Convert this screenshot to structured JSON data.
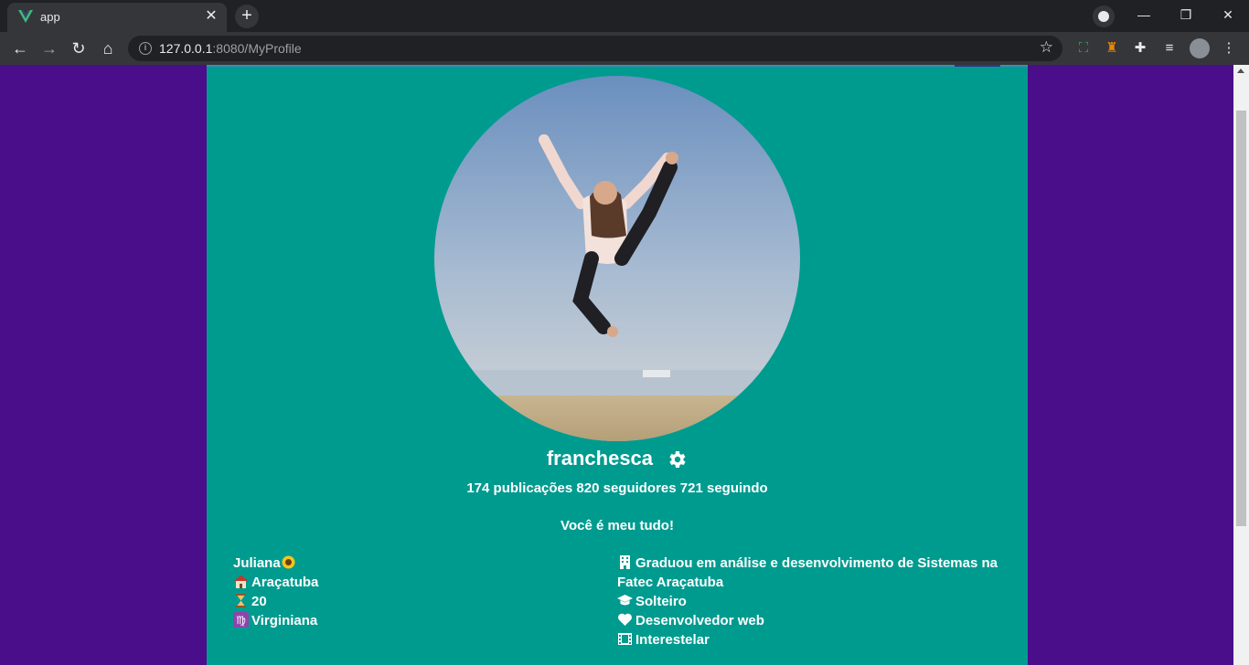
{
  "browser": {
    "tab_title": "app",
    "url_host": "127.0.0.1",
    "url_rest": ":8080/MyProfile"
  },
  "profile": {
    "username": "franchesca",
    "stats": "174 publicações 820 seguidores 721 seguindo",
    "bio": "Você é meu tudo!",
    "left_info": {
      "name": "Juliana",
      "city": "Araçatuba",
      "age": "20",
      "sign": "Virginiana"
    },
    "right_info": {
      "education_line1": "Graduou em análise e desenvolvimento de Sistemas na",
      "education_line2": "Fatec Araçatuba",
      "relationship": "Solteiro",
      "work": "Desenvolvedor web",
      "interest": "Interestelar"
    }
  },
  "colors": {
    "page_bg": "#4a0e8a",
    "card_bg": "#009b8f"
  }
}
